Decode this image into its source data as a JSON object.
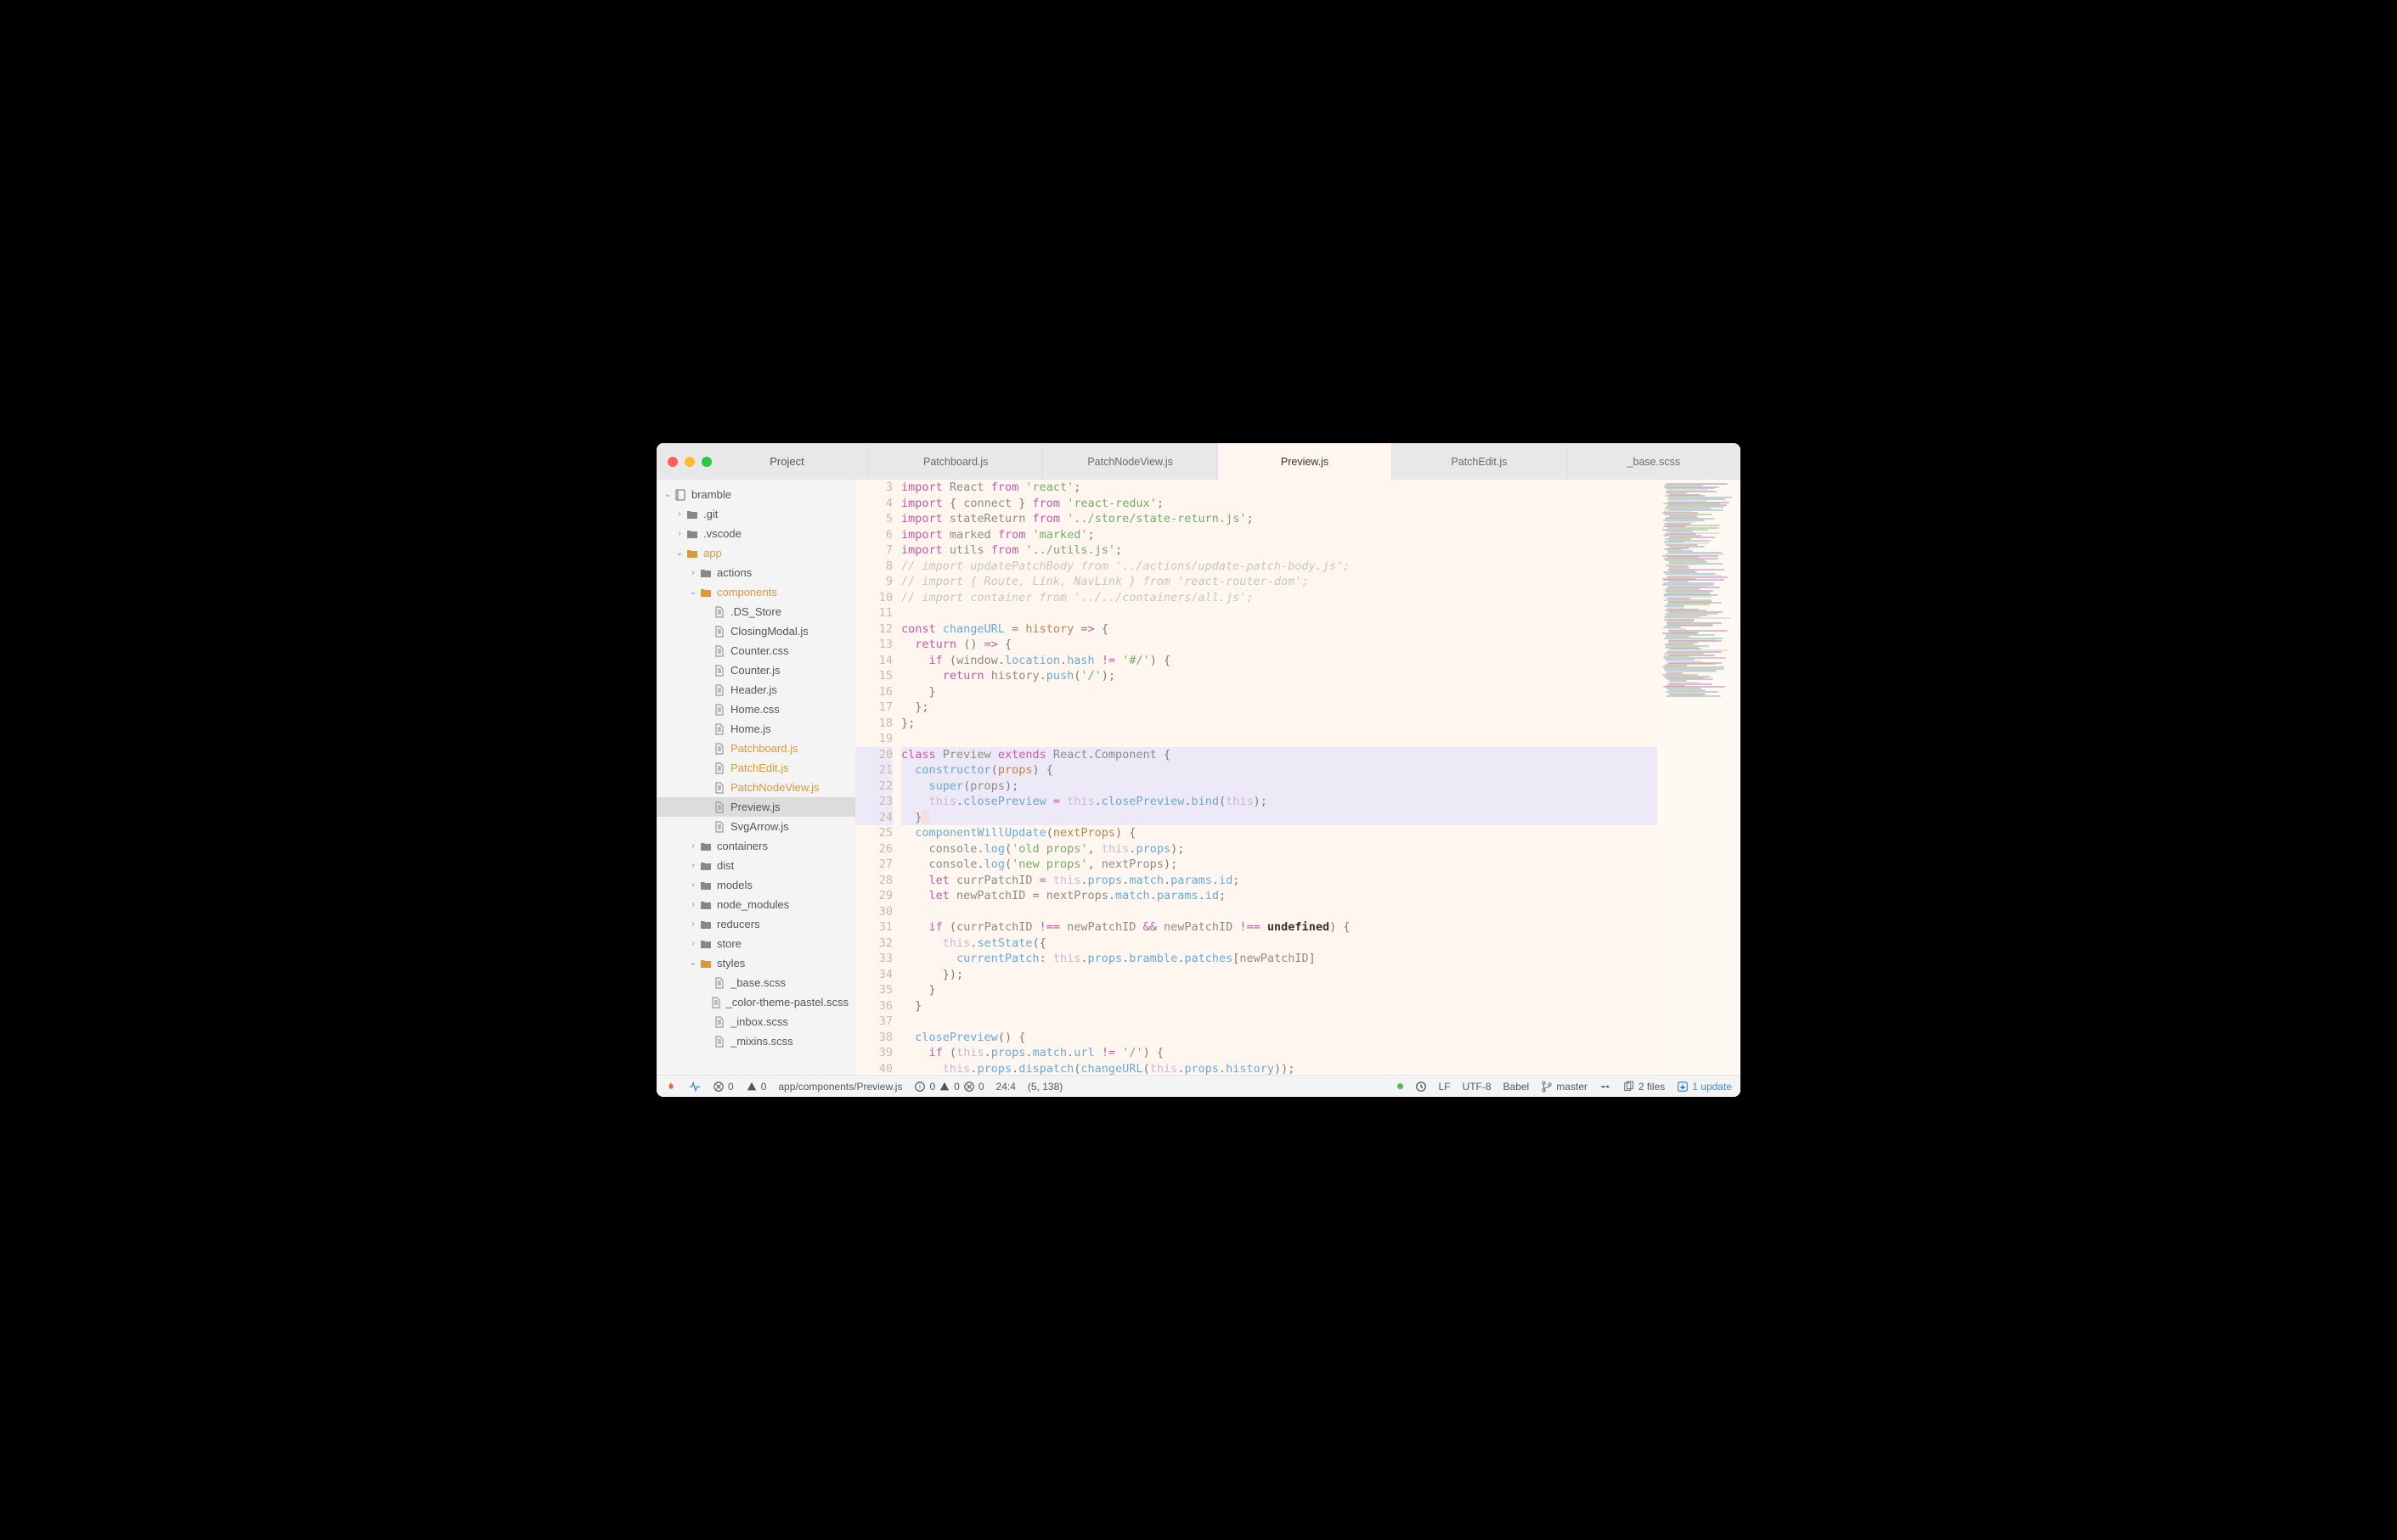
{
  "window": {
    "project_label": "Project"
  },
  "tabs": [
    {
      "label": "Patchboard.js",
      "active": false
    },
    {
      "label": "PatchNodeView.js",
      "active": false
    },
    {
      "label": "Preview.js",
      "active": true
    },
    {
      "label": "PatchEdit.js",
      "active": false
    },
    {
      "label": "_base.scss",
      "active": false
    }
  ],
  "tree": [
    {
      "depth": 0,
      "type": "repo",
      "label": "bramble",
      "chev": "down"
    },
    {
      "depth": 1,
      "type": "folder",
      "label": ".git",
      "chev": "right"
    },
    {
      "depth": 1,
      "type": "folder",
      "label": ".vscode",
      "chev": "right"
    },
    {
      "depth": 1,
      "type": "folder-open",
      "label": "app",
      "chev": "down",
      "highlight": true
    },
    {
      "depth": 2,
      "type": "folder",
      "label": "actions",
      "chev": "right"
    },
    {
      "depth": 2,
      "type": "folder-open",
      "label": "components",
      "chev": "down",
      "highlight": true
    },
    {
      "depth": 3,
      "type": "file",
      "label": ".DS_Store"
    },
    {
      "depth": 3,
      "type": "file",
      "label": "ClosingModal.js"
    },
    {
      "depth": 3,
      "type": "file",
      "label": "Counter.css"
    },
    {
      "depth": 3,
      "type": "file",
      "label": "Counter.js"
    },
    {
      "depth": 3,
      "type": "file",
      "label": "Header.js"
    },
    {
      "depth": 3,
      "type": "file",
      "label": "Home.css"
    },
    {
      "depth": 3,
      "type": "file",
      "label": "Home.js"
    },
    {
      "depth": 3,
      "type": "file",
      "label": "Patchboard.js",
      "highlight": true
    },
    {
      "depth": 3,
      "type": "file",
      "label": "PatchEdit.js",
      "highlight": true
    },
    {
      "depth": 3,
      "type": "file",
      "label": "PatchNodeView.js",
      "highlight": true
    },
    {
      "depth": 3,
      "type": "file",
      "label": "Preview.js",
      "selected": true
    },
    {
      "depth": 3,
      "type": "file",
      "label": "SvgArrow.js"
    },
    {
      "depth": 2,
      "type": "folder",
      "label": "containers",
      "chev": "right"
    },
    {
      "depth": 2,
      "type": "folder",
      "label": "dist",
      "chev": "right"
    },
    {
      "depth": 2,
      "type": "folder",
      "label": "models",
      "chev": "right"
    },
    {
      "depth": 2,
      "type": "folder",
      "label": "node_modules",
      "chev": "right"
    },
    {
      "depth": 2,
      "type": "folder",
      "label": "reducers",
      "chev": "right"
    },
    {
      "depth": 2,
      "type": "folder",
      "label": "store",
      "chev": "right"
    },
    {
      "depth": 2,
      "type": "folder-open",
      "label": "styles",
      "chev": "down"
    },
    {
      "depth": 3,
      "type": "file",
      "label": "_base.scss"
    },
    {
      "depth": 3,
      "type": "file",
      "label": "_color-theme-pastel.scss"
    },
    {
      "depth": 3,
      "type": "file",
      "label": "_inbox.scss"
    },
    {
      "depth": 3,
      "type": "file",
      "label": "_mixins.scss"
    }
  ],
  "code": {
    "first_line": 3,
    "lines": [
      {
        "n": 3,
        "html": "<span class='k-import'>import</span> <span class='ident'>React</span> <span class='k-from'>from</span> <span class='s'>'react'</span><span class='punct'>;</span>"
      },
      {
        "n": 4,
        "html": "<span class='k-import'>import</span> <span class='brace'>{</span> <span class='ident'>connect</span> <span class='brace'>}</span> <span class='k-from'>from</span> <span class='s'>'react-redux'</span><span class='punct'>;</span>"
      },
      {
        "n": 5,
        "html": "<span class='k-import'>import</span> <span class='ident'>stateReturn</span> <span class='k-from'>from</span> <span class='s'>'../store/state-return.js'</span><span class='punct'>;</span>"
      },
      {
        "n": 6,
        "html": "<span class='k-import'>import</span> <span class='ident'>marked</span> <span class='k-from'>from</span> <span class='s'>'marked'</span><span class='punct'>;</span>"
      },
      {
        "n": 7,
        "html": "<span class='k-import'>import</span> <span class='ident'>utils</span> <span class='k-from'>from</span> <span class='s'>'../utils.js'</span><span class='punct'>;</span>"
      },
      {
        "n": 8,
        "html": "<span class='comment'>// import updatePatchBody from '../actions/update-patch-body.js';</span>"
      },
      {
        "n": 9,
        "html": "<span class='comment'>// import { Route, Link, NavLink } from 'react-router-dom';</span>"
      },
      {
        "n": 10,
        "html": "<span class='comment'>// import container from '../../containers/all.js';</span>"
      },
      {
        "n": 11,
        "html": ""
      },
      {
        "n": 12,
        "html": "<span class='k-const'>const</span> <span class='fn'>changeURL</span> <span class='op'>=</span> <span class='param'>history</span> <span class='op'>=&gt;</span> <span class='brace'>{</span>"
      },
      {
        "n": 13,
        "html": "  <span class='k-return'>return</span> <span class='brace'>()</span> <span class='op'>=&gt;</span> <span class='brace'>{</span>"
      },
      {
        "n": 14,
        "html": "    <span class='k-if'>if</span> <span class='brace'>(</span><span class='ident'>window</span><span class='punct'>.</span><span class='prop'>location</span><span class='punct'>.</span><span class='prop'>hash</span> <span class='op'>!=</span> <span class='s'>'#/'</span><span class='brace'>)</span> <span class='brace'>{</span>"
      },
      {
        "n": 15,
        "html": "      <span class='k-return'>return</span> <span class='ident'>history</span><span class='punct'>.</span><span class='fn'>push</span><span class='brace'>(</span><span class='s'>'/'</span><span class='brace'>)</span><span class='punct'>;</span>"
      },
      {
        "n": 16,
        "html": "    <span class='brace'>}</span>"
      },
      {
        "n": 17,
        "html": "  <span class='brace'>}</span><span class='punct'>;</span>"
      },
      {
        "n": 18,
        "html": "<span class='brace'>}</span><span class='punct'>;</span>"
      },
      {
        "n": 19,
        "html": ""
      },
      {
        "n": 20,
        "hl": true,
        "html": "<span class='k-class'>class</span> <span class='ident'>Preview</span> <span class='k-extends'>extends</span> <span class='ident'>React</span><span class='punct'>.</span><span class='ident'>Component</span> <span class='brace'>{</span>"
      },
      {
        "n": 21,
        "hl": true,
        "html": "  <span class='fn'>constructor</span><span class='brace'>(</span><span class='param'>props</span><span class='brace'>)</span> <span class='brace'>{</span>"
      },
      {
        "n": 22,
        "hl": true,
        "html": "    <span class='k-super'>super</span><span class='brace'>(</span><span class='ident'>props</span><span class='brace'>)</span><span class='punct'>;</span>"
      },
      {
        "n": 23,
        "hl": true,
        "html": "    <span class='this'>this</span><span class='punct'>.</span><span class='prop'>closePreview</span> <span class='op'>=</span> <span class='this'>this</span><span class='punct'>.</span><span class='prop'>closePreview</span><span class='punct'>.</span><span class='fn'>bind</span><span class='brace'>(</span><span class='this'>this</span><span class='brace'>)</span><span class='punct'>;</span>"
      },
      {
        "n": 24,
        "hl": true,
        "cursor": true,
        "html": "  <span class='brace'>}</span><span class='cursorpos'>&nbsp;</span>"
      },
      {
        "n": 25,
        "html": "  <span class='fn'>componentWillUpdate</span><span class='brace'>(</span><span class='param'>nextProps</span><span class='brace'>)</span> <span class='brace'>{</span>"
      },
      {
        "n": 26,
        "html": "    <span class='ident'>console</span><span class='punct'>.</span><span class='fn'>log</span><span class='brace'>(</span><span class='s'>'old props'</span><span class='punct'>,</span> <span class='this'>this</span><span class='punct'>.</span><span class='prop'>props</span><span class='brace'>)</span><span class='punct'>;</span>"
      },
      {
        "n": 27,
        "html": "    <span class='ident'>console</span><span class='punct'>.</span><span class='fn'>log</span><span class='brace'>(</span><span class='s'>'new props'</span><span class='punct'>,</span> <span class='ident'>nextProps</span><span class='brace'>)</span><span class='punct'>;</span>"
      },
      {
        "n": 28,
        "html": "    <span class='k-let'>let</span> <span class='ident'>currPatchID</span> <span class='op'>=</span> <span class='this'>this</span><span class='punct'>.</span><span class='prop'>props</span><span class='punct'>.</span><span class='prop'>match</span><span class='punct'>.</span><span class='prop'>params</span><span class='punct'>.</span><span class='prop'>id</span><span class='punct'>;</span>"
      },
      {
        "n": 29,
        "html": "    <span class='k-let'>let</span> <span class='ident'>newPatchID</span> <span class='op'>=</span> <span class='ident'>nextProps</span><span class='punct'>.</span><span class='prop'>match</span><span class='punct'>.</span><span class='prop'>params</span><span class='punct'>.</span><span class='prop'>id</span><span class='punct'>;</span>"
      },
      {
        "n": 30,
        "html": ""
      },
      {
        "n": 31,
        "html": "    <span class='k-if'>if</span> <span class='brace'>(</span><span class='ident'>currPatchID</span> <span class='op'>!==</span> <span class='ident'>newPatchID</span> <span class='op'>&amp;&amp;</span> <span class='ident'>newPatchID</span> <span class='op'>!==</span> <span class='bold-black'>undefined</span><span class='brace'>)</span> <span class='brace'>{</span>"
      },
      {
        "n": 32,
        "html": "      <span class='this'>this</span><span class='punct'>.</span><span class='fn'>setState</span><span class='brace'>({</span>"
      },
      {
        "n": 33,
        "html": "        <span class='attr'>currentPatch</span><span class='punct'>:</span> <span class='this'>this</span><span class='punct'>.</span><span class='prop'>props</span><span class='punct'>.</span><span class='prop'>bramble</span><span class='punct'>.</span><span class='prop'>patches</span><span class='brace'>[</span><span class='ident'>newPatchID</span><span class='brace'>]</span>"
      },
      {
        "n": 34,
        "html": "      <span class='brace'>})</span><span class='punct'>;</span>"
      },
      {
        "n": 35,
        "html": "    <span class='brace'>}</span>"
      },
      {
        "n": 36,
        "html": "  <span class='brace'>}</span>"
      },
      {
        "n": 37,
        "html": ""
      },
      {
        "n": 38,
        "html": "  <span class='fn'>closePreview</span><span class='brace'>()</span> <span class='brace'>{</span>"
      },
      {
        "n": 39,
        "html": "    <span class='k-if'>if</span> <span class='brace'>(</span><span class='this'>this</span><span class='punct'>.</span><span class='prop'>props</span><span class='punct'>.</span><span class='prop'>match</span><span class='punct'>.</span><span class='prop'>url</span> <span class='op'>!=</span> <span class='s'>'/'</span><span class='brace'>)</span> <span class='brace'>{</span>"
      },
      {
        "n": 40,
        "html": "      <span class='this'>this</span><span class='punct'>.</span><span class='prop'>props</span><span class='punct'>.</span><span class='fn'>dispatch</span><span class='brace'>(</span><span class='fn'>changeURL</span><span class='brace'>(</span><span class='this'>this</span><span class='punct'>.</span><span class='prop'>props</span><span class='punct'>.</span><span class='prop'>history</span><span class='brace'>))</span><span class='punct'>;</span>"
      }
    ]
  },
  "status": {
    "errors": "0",
    "warnings": "0",
    "path": "app/components/Preview.js",
    "diag_info": "0",
    "diag_warn": "0",
    "diag_err": "0",
    "cursor": "24:4",
    "selection": "(5, 138)",
    "eol": "LF",
    "encoding": "UTF-8",
    "grammar": "Babel",
    "branch": "master",
    "files": "2 files",
    "updates": "1 update"
  }
}
